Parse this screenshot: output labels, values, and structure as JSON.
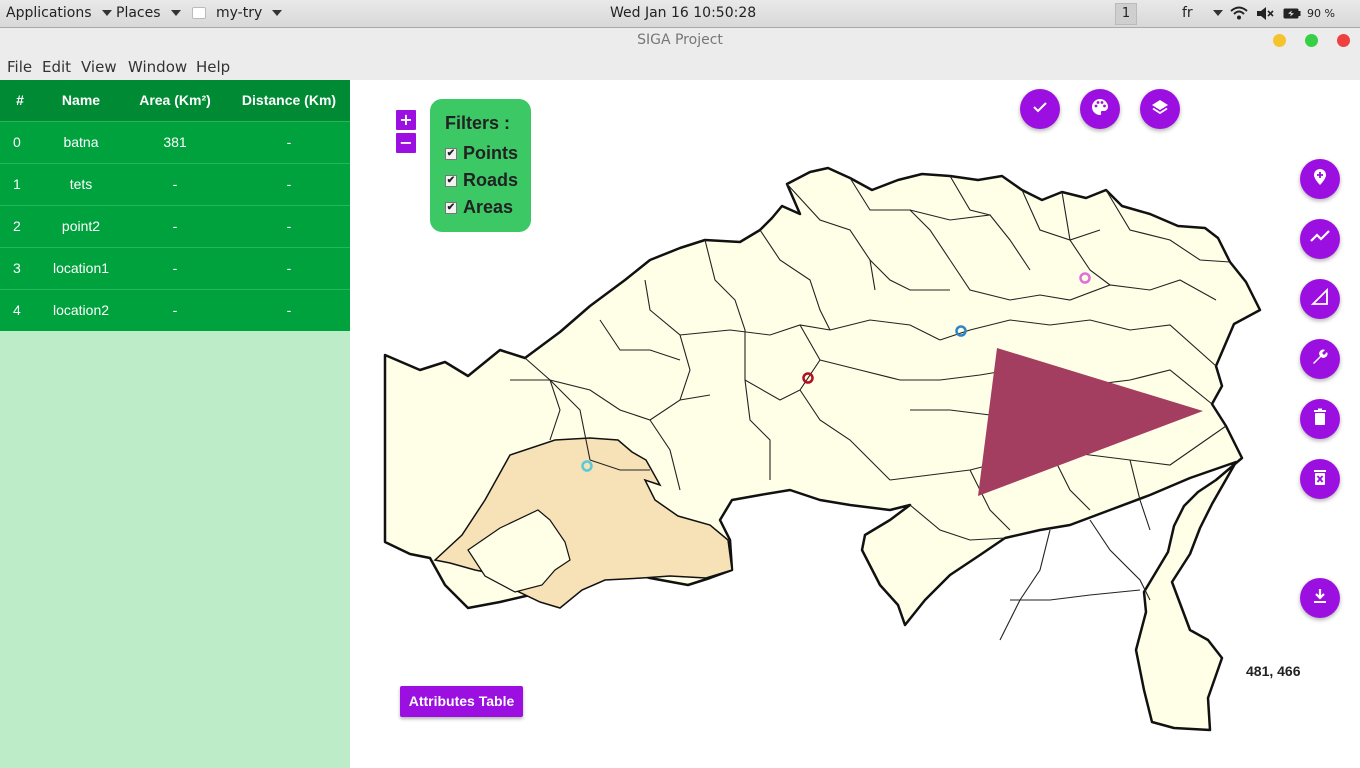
{
  "top_panel": {
    "applications": "Applications",
    "places": "Places",
    "window_name": "my-try",
    "clock": "Wed Jan 16  10:50:28",
    "workspace": "1",
    "language": "fr",
    "battery": "90 %"
  },
  "window": {
    "title": "SIGA Project"
  },
  "menu": {
    "file": "File",
    "edit": "Edit",
    "view": "View",
    "window": "Window",
    "help": "Help"
  },
  "table": {
    "headers": [
      "#",
      "Name",
      "Area (Km²)",
      "Distance (Km)"
    ],
    "rows": [
      {
        "id": "0",
        "name": "batna",
        "area": "381",
        "distance": "-"
      },
      {
        "id": "1",
        "name": "tets",
        "area": "-",
        "distance": "-"
      },
      {
        "id": "2",
        "name": "point2",
        "area": "-",
        "distance": "-"
      },
      {
        "id": "3",
        "name": "location1",
        "area": "-",
        "distance": "-"
      },
      {
        "id": "4",
        "name": "location2",
        "area": "-",
        "distance": "-"
      }
    ]
  },
  "zoom": {
    "in": "+",
    "out": "−"
  },
  "filters": {
    "title": "Filters :",
    "items": [
      {
        "label": "Points",
        "checked": true
      },
      {
        "label": "Roads",
        "checked": true
      },
      {
        "label": "Areas",
        "checked": true
      }
    ]
  },
  "coords": "481, 466",
  "attributes_button": "Attributes Table",
  "colors": {
    "accent": "#9b0fe0",
    "table_header": "#008a34",
    "table_row": "#00a23e",
    "panel_bg": "#bdecc9",
    "filter_bg": "#3dc866",
    "map_fill": "#ffffe8",
    "highlight_area": "#f7e2b8",
    "triangle": "#a33e60"
  },
  "toolbar_icons": [
    "check-icon",
    "palette-icon",
    "layers-icon"
  ],
  "side_icons": [
    "add-point-icon",
    "draw-line-icon",
    "draw-polygon-icon",
    "wrench-icon",
    "trash-icon",
    "delete-all-icon",
    "download-icon"
  ]
}
